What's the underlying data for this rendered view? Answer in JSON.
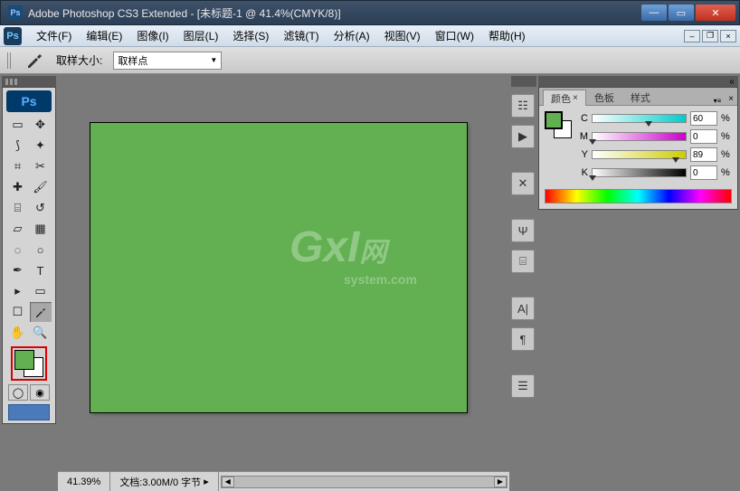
{
  "title": "Adobe Photoshop CS3 Extended - [未标题-1 @ 41.4%(CMYK/8)]",
  "menu": {
    "file": "文件(F)",
    "edit": "编辑(E)",
    "image": "图像(I)",
    "layer": "图层(L)",
    "select": "选择(S)",
    "filter": "滤镜(T)",
    "analysis": "分析(A)",
    "view": "视图(V)",
    "window": "窗口(W)",
    "help": "帮助(H)"
  },
  "options": {
    "sample_label": "取样大小:",
    "sample_value": "取样点"
  },
  "status": {
    "zoom": "41.39%",
    "doc": "文档:3.00M/0 字节"
  },
  "panel": {
    "tab_color": "颜色",
    "tab_swatch": "色板",
    "tab_style": "样式",
    "c_label": "C",
    "c_value": "60",
    "m_label": "M",
    "m_value": "0",
    "y_label": "Y",
    "y_value": "89",
    "k_label": "K",
    "k_value": "0",
    "pct": "%"
  },
  "colors": {
    "foreground": "#62b052",
    "background": "#ffffff"
  },
  "watermark": {
    "main": "GxI",
    "sub": "system.com",
    "side": "网"
  }
}
